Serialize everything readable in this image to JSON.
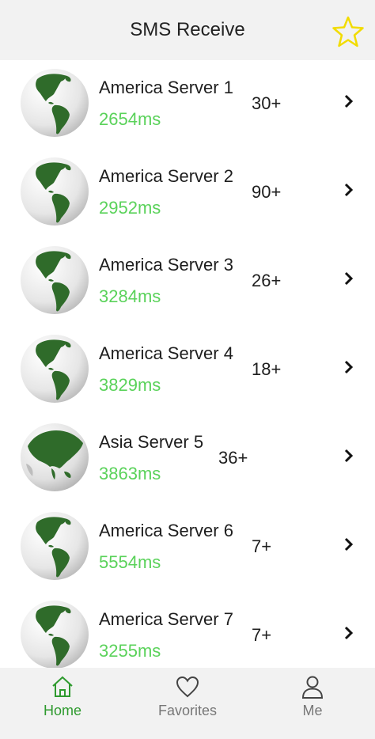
{
  "header": {
    "title": "SMS Receive",
    "favorite_icon": "star-icon"
  },
  "colors": {
    "latency": "#5ad25a",
    "active_nav": "#2e9a2e",
    "star": "#f5e000",
    "land": "#2f6b2a"
  },
  "servers": [
    {
      "name": "America Server 1",
      "latency": "2654ms",
      "count": "30+",
      "globe": "america"
    },
    {
      "name": "America Server 2",
      "latency": "2952ms",
      "count": "90+",
      "globe": "america"
    },
    {
      "name": "America Server 3",
      "latency": "3284ms",
      "count": "26+",
      "globe": "america"
    },
    {
      "name": "America Server 4",
      "latency": "3829ms",
      "count": "18+",
      "globe": "america"
    },
    {
      "name": "Asia Server 5",
      "latency": "3863ms",
      "count": "36+",
      "globe": "asia"
    },
    {
      "name": "America Server 6",
      "latency": "5554ms",
      "count": "7+",
      "globe": "america"
    },
    {
      "name": "America Server 7",
      "latency": "3255ms",
      "count": "7+",
      "globe": "america"
    }
  ],
  "nav": {
    "items": [
      {
        "label": "Home",
        "icon": "home-icon",
        "active": true
      },
      {
        "label": "Favorites",
        "icon": "heart-icon",
        "active": false
      },
      {
        "label": "Me",
        "icon": "user-icon",
        "active": false
      }
    ]
  }
}
